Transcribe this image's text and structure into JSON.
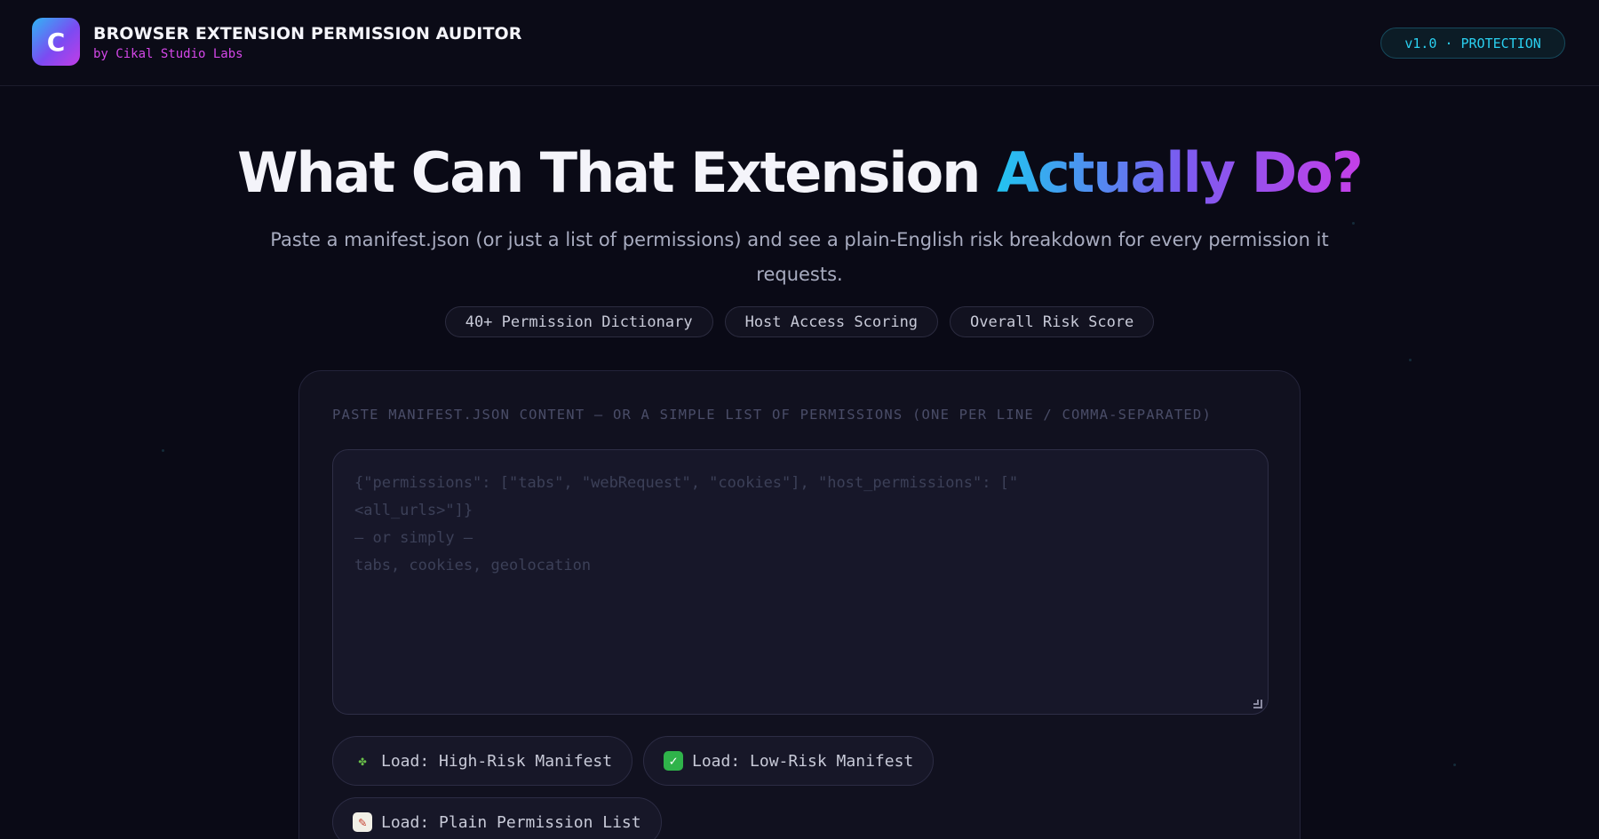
{
  "header": {
    "logo_letter": "C",
    "title": "BROWSER EXTENSION PERMISSION AUDITOR",
    "subtitle": "by Cikal Studio Labs",
    "version_badge": "v1.0 · PROTECTION"
  },
  "hero": {
    "title_main": "What Can That Extension ",
    "title_accent": "Actually Do?",
    "description": "Paste a manifest.json (or just a list of permissions) and see a plain-English risk breakdown for every permission it requests.",
    "tags": [
      "40+ Permission Dictionary",
      "Host Access Scoring",
      "Overall Risk Score"
    ]
  },
  "input": {
    "label": "Paste manifest.json content — or a simple list of permissions (one per line / comma-separated)",
    "placeholder_lines": [
      "{\"permissions\": [\"tabs\", \"webRequest\", \"cookies\"], \"host_permissions\": [\"",
      "<all_urls>\"]}",
      "",
      "— or simply —",
      "tabs, cookies, geolocation"
    ]
  },
  "buttons": {
    "high_risk": "Load: High-Risk Manifest",
    "low_risk": "Load: Low-Risk Manifest",
    "plain_list": "Load: Plain Permission List"
  },
  "icons": {
    "high_risk": "puzzle-icon",
    "low_risk": "check-icon",
    "plain_list": "memo-icon"
  },
  "colors": {
    "background": "#0a0a16",
    "accent_cyan": "#22c4f0",
    "accent_purple": "#c53fe8",
    "badge_text": "#2ad0f0"
  }
}
